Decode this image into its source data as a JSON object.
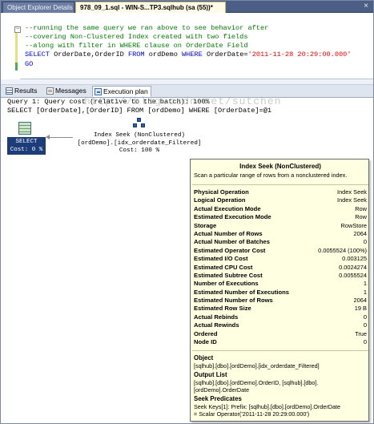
{
  "doc_tabs": [
    {
      "label": "Object Explorer Details"
    },
    {
      "label": "978_09_1.sql - WIN-S...TP3.sqlhub (sa (55))*"
    }
  ],
  "close_glyph": "×",
  "editor": {
    "fold_glyph": "−",
    "comment1": "--running the same query we ran above to see behavior after",
    "comment2": "--covering Non-Clustered Index created with two fields",
    "comment3": "--along with filter in WHERE clause on OrderDate Field",
    "sql_select": "SELECT",
    "sql_cols": " OrderDate,OrderID ",
    "sql_from": "FROM",
    "sql_table": " ordDemo ",
    "sql_where": "WHERE",
    "sql_cond": " OrderDate=",
    "sql_value": "'2011-11-28 20:29:00.000'",
    "go": "GO"
  },
  "result_tabs": [
    {
      "label": "Results"
    },
    {
      "label": "Messages"
    },
    {
      "label": "Execution plan"
    }
  ],
  "plan": {
    "query_cost_line": "Query 1: Query cost (relative to the batch): 100%",
    "query_text_line": "SELECT [OrderDate],[OrderID] FROM [ordDemo] WHERE [OrderDate]=@1",
    "select_node": {
      "label": "SELECT",
      "cost": "Cost: 0 %"
    },
    "seek_node": {
      "line1": "Index Seek (NonClustered)",
      "line2": "[ordDemo].[idx_orderdate_Filtered]",
      "line3": "Cost: 100 %"
    }
  },
  "watermark": "http://blog.csdn.net/sutchen",
  "tooltip": {
    "title": "Index Seek (NonClustered)",
    "description": "Scan a particular range of rows from a nonclustered index.",
    "rows": [
      {
        "k": "Physical Operation",
        "v": "Index Seek"
      },
      {
        "k": "Logical Operation",
        "v": "Index Seek"
      },
      {
        "k": "Actual Execution Mode",
        "v": "Row"
      },
      {
        "k": "Estimated Execution Mode",
        "v": "Row"
      },
      {
        "k": "Storage",
        "v": "RowStore"
      },
      {
        "k": "Actual Number of Rows",
        "v": "2064"
      },
      {
        "k": "Actual Number of Batches",
        "v": "0"
      },
      {
        "k": "Estimated Operator Cost",
        "v": "0.0055524 (100%)"
      },
      {
        "k": "Estimated I/O Cost",
        "v": "0.003125"
      },
      {
        "k": "Estimated CPU Cost",
        "v": "0.0024274"
      },
      {
        "k": "Estimated Subtree Cost",
        "v": "0.0055524"
      },
      {
        "k": "Number of Executions",
        "v": "1"
      },
      {
        "k": "Estimated Number of Executions",
        "v": "1"
      },
      {
        "k": "Estimated Number of Rows",
        "v": "2064"
      },
      {
        "k": "Estimated Row Size",
        "v": "19 B"
      },
      {
        "k": "Actual Rebinds",
        "v": "0"
      },
      {
        "k": "Actual Rewinds",
        "v": "0"
      },
      {
        "k": "Ordered",
        "v": "True"
      },
      {
        "k": "Node ID",
        "v": "0"
      }
    ],
    "object_heading": "Object",
    "object_text": "[sqlhub].[dbo].[ordDemo].[idx_orderdate_Filtered]",
    "output_heading": "Output List",
    "output_text": "[sqlhub].[dbo].[ordDemo].OrderID, [sqlhub].[dbo].\n[ordDemo].OrderDate",
    "seek_heading": "Seek Predicates",
    "seek_text": "Seek Keys[1]: Prefix: [sqlhub].[dbo].[ordDemo].OrderDate\n= Scalar Operator('2011-11-28 20:29:00.000')"
  }
}
